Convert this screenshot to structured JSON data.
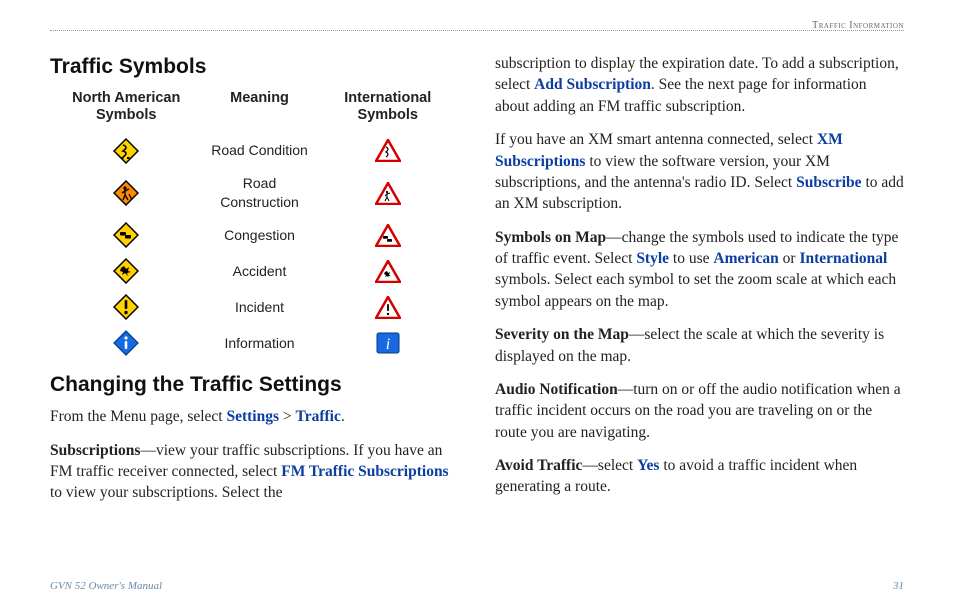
{
  "running_head": "Traffic Information",
  "h_traffic_symbols": "Traffic Symbols",
  "table": {
    "col1": "North American Symbols",
    "col2": "Meaning",
    "col3": "International Symbols",
    "rows": [
      {
        "meaning": "Road Condition"
      },
      {
        "meaning": "Road Construction"
      },
      {
        "meaning": "Congestion"
      },
      {
        "meaning": "Accident"
      },
      {
        "meaning": "Incident"
      },
      {
        "meaning": "Information"
      }
    ]
  },
  "h_changing": "Changing the Traffic Settings",
  "left": {
    "from_menu_1": "From the Menu page, select ",
    "settings": "Settings",
    "gt": " > ",
    "traffic": "Traffic",
    "period": ".",
    "subs_label": "Subscriptions",
    "subs_dash": "—view your traffic subscriptions. If you have an FM traffic receiver connected, select ",
    "fm_link": "FM Traffic Subscriptions",
    "subs_tail": " to view your subscriptions. Select the"
  },
  "right": {
    "p1_a": "subscription to display the expiration date. To add a subscription, select ",
    "p1_link": "Add Subscription",
    "p1_b": ". See the next page for information about adding an FM traffic subscription.",
    "p2_a": "If you have an XM smart antenna connected, select ",
    "p2_link1": "XM Subscriptions",
    "p2_b": " to view the software version, your XM subscriptions, and the antenna's radio ID. Select ",
    "p2_link2": "Subscribe",
    "p2_c": " to add an XM subscription.",
    "p3_label": "Symbols on Map",
    "p3_a": "—change the symbols used to indicate the type of traffic event. Select ",
    "p3_link1": "Style",
    "p3_b": " to use ",
    "p3_link2": "American",
    "p3_c": " or ",
    "p3_link3": "International",
    "p3_d": " symbols. Select each symbol to set the zoom scale at which each symbol appears on the map.",
    "p4_label": "Severity on the Map",
    "p4_a": "—select the scale at which the severity is displayed on the map.",
    "p5_label": "Audio Notification",
    "p5_a": "—turn on or off the audio notification when a traffic incident occurs on the road you are traveling on or the route you are navigating.",
    "p6_label": "Avoid Traffic",
    "p6_a": "—select ",
    "p6_link": "Yes",
    "p6_b": " to avoid a traffic incident when generating a route."
  },
  "footer": {
    "manual": "GVN 52 Owner's Manual",
    "page": "31"
  }
}
